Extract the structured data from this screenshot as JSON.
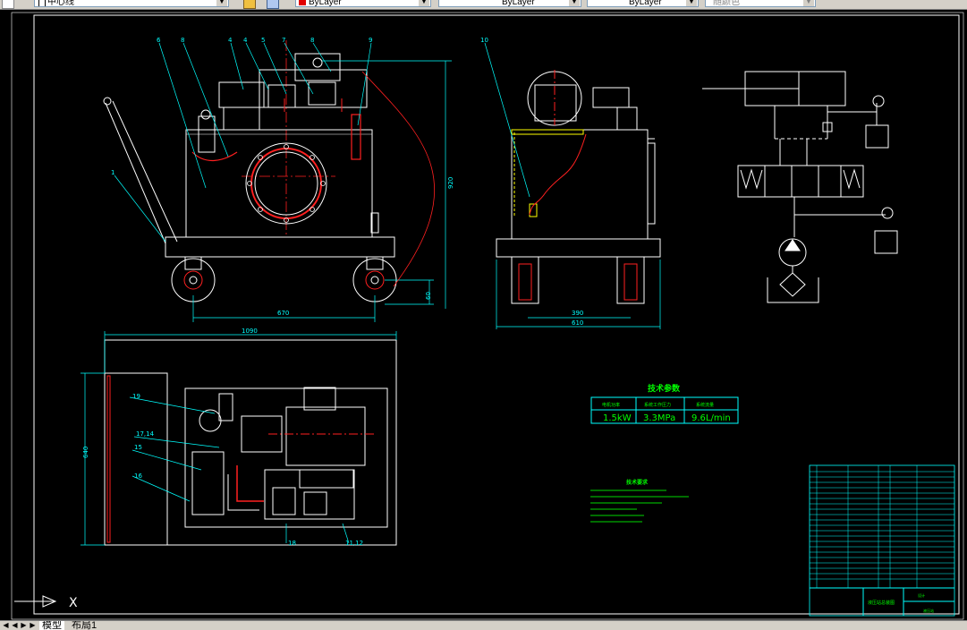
{
  "toolbar": {
    "layer_name": "中心线",
    "color_control": "ByLayer",
    "linetype_control": "ByLayer",
    "lineweight_control": "ByLayer",
    "plotstyle_control": "随颜色"
  },
  "drawing": {
    "front_view": {
      "balloons": [
        "6",
        "8",
        "4",
        "4",
        "5",
        "7",
        "8",
        "9",
        "1"
      ],
      "dim_height": "920",
      "dim_width": "670",
      "dim_wheel": "60"
    },
    "side_view": {
      "balloons": [
        "10"
      ],
      "dim_inner": "390",
      "dim_outer": "610"
    },
    "top_view": {
      "dim_length": "1090",
      "dim_width": "640",
      "balloons": [
        "19",
        "17,14",
        "15",
        "16",
        "18",
        "11,12"
      ]
    },
    "tech_params": {
      "title": "技术参数",
      "headers": [
        "电机功率",
        "系统工作压力",
        "系统流量"
      ],
      "values": [
        "1.5kW",
        "3.3MPa",
        "9.6L/min"
      ]
    },
    "tech_requirements": {
      "title": "技术要求"
    },
    "title_block": {
      "drawing_name": "液压站总装图",
      "drawing_no": "液压站",
      "unit": "设计"
    }
  },
  "layout_tabs": [
    "模型",
    "布局1"
  ],
  "ucs_axis_label": "X"
}
